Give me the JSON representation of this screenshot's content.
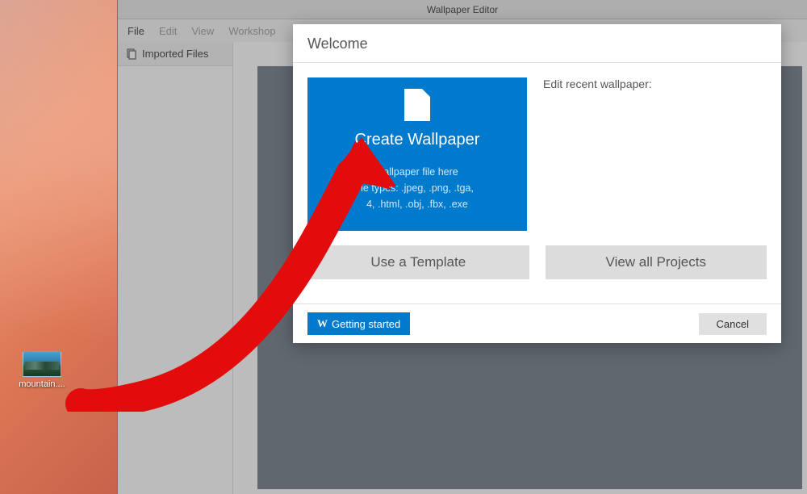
{
  "desktop": {
    "icon_label": "mountain...."
  },
  "editor": {
    "title": "Wallpaper Editor",
    "menu": [
      "File",
      "Edit",
      "View",
      "Workshop"
    ],
    "side_panel_title": "Imported Files"
  },
  "dialog": {
    "title": "Welcome",
    "create": {
      "title": "Create Wallpaper",
      "sub1": "wallpaper file here",
      "sub2": "le types: .jpeg, .png, .tga,",
      "sub3": "4, .html, .obj, .fbx, .exe"
    },
    "recent_label": "Edit recent wallpaper:",
    "use_template": "Use a Template",
    "view_all": "View all Projects",
    "getting_started": "Getting started",
    "cancel": "Cancel"
  }
}
